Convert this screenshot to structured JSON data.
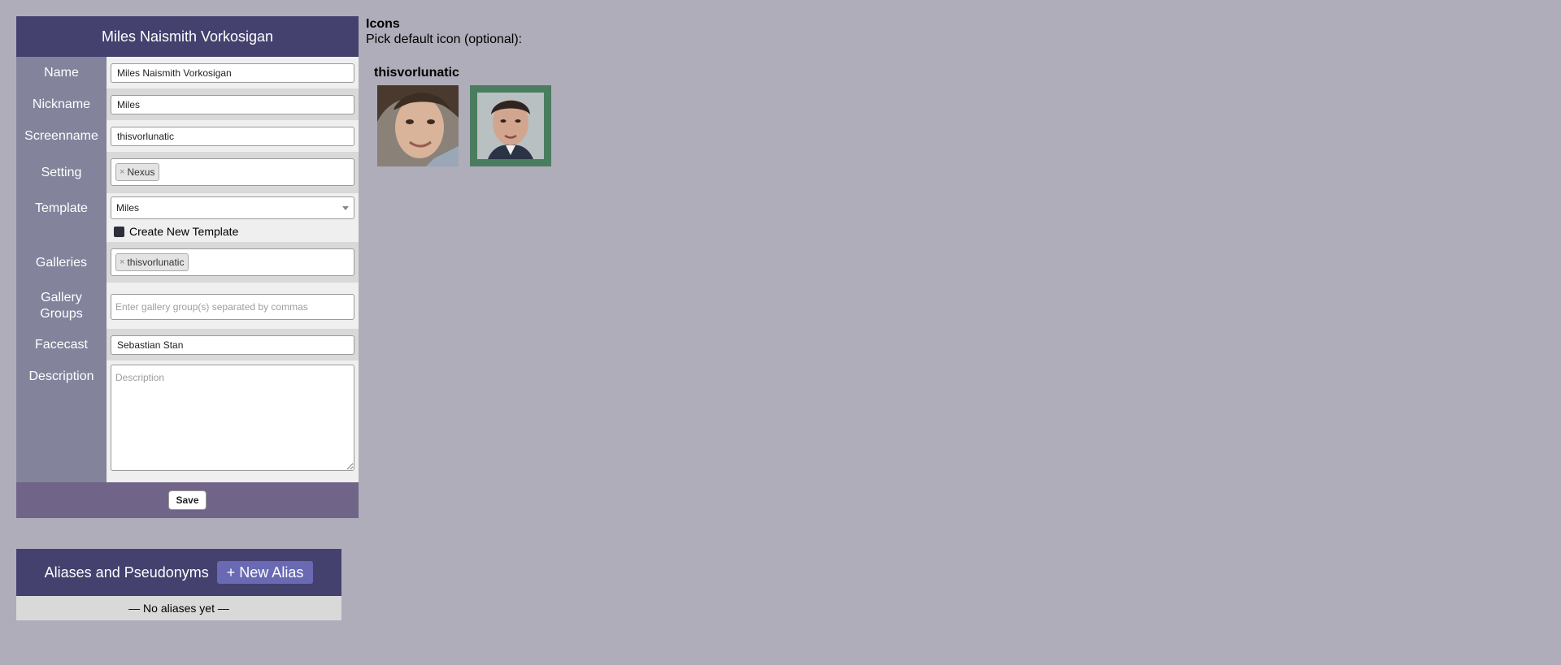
{
  "form": {
    "title": "Miles Naismith Vorkosigan",
    "fields": {
      "name": {
        "label": "Name",
        "value": "Miles Naismith Vorkosigan"
      },
      "nickname": {
        "label": "Nickname",
        "value": "Miles"
      },
      "screenname": {
        "label": "Screenname",
        "value": "thisvorlunatic"
      },
      "setting": {
        "label": "Setting",
        "tags": [
          "Nexus"
        ]
      },
      "template": {
        "label": "Template",
        "selected": "Miles",
        "create_new_label": "Create New Template"
      },
      "galleries": {
        "label": "Galleries",
        "tags": [
          "thisvorlunatic"
        ]
      },
      "gallery_groups": {
        "label": "Gallery Groups",
        "label_line1": "Gallery",
        "label_line2": "Groups",
        "placeholder": "Enter gallery group(s) separated by commas"
      },
      "facecast": {
        "label": "Facecast",
        "value": "Sebastian Stan"
      },
      "description": {
        "label": "Description",
        "placeholder": "Description"
      }
    },
    "save_label": "Save",
    "tag_remove_glyph": "×"
  },
  "aliases": {
    "title": "Aliases and Pseudonyms",
    "new_button_label": "+ New Alias",
    "empty_text": "— No aliases yet —"
  },
  "icons": {
    "title": "Icons",
    "subtitle": "Pick default icon (optional):",
    "gallery_name": "thisvorlunatic",
    "items": [
      {
        "selected": false,
        "icon": "portrait-photo-icon"
      },
      {
        "selected": true,
        "icon": "portrait-photo-icon",
        "highlight_color": "#4a7d5f"
      }
    ]
  },
  "colors": {
    "header": "#44416f",
    "label_column": "#83839c",
    "footer": "#706488",
    "new_alias_button": "#6a69b4",
    "page_background": "#aeadb9"
  }
}
